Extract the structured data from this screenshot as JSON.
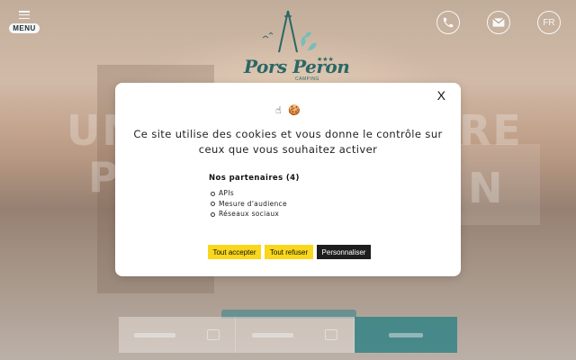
{
  "header": {
    "menu_label": "MENU",
    "lang_label": "FR",
    "logo": {
      "text": "Pors Peron",
      "stars": "★★★",
      "subtitle": "CAMPING"
    }
  },
  "hero": {
    "ghost_1": "UN",
    "ghost_2": "RE",
    "ghost_3": "P",
    "ghost_4": "N"
  },
  "cookie_modal": {
    "close_label": "X",
    "icon_1": "☝",
    "icon_2": "🍪",
    "message": "Ce site utilise des cookies et vous donne le contrôle sur ceux que vous souhaitez activer",
    "partners_title": "Nos partenaires (4)",
    "partners": [
      "APIs",
      "Mesure d'audience",
      "Réseaux sociaux"
    ],
    "accept_label": "Tout accepter",
    "refuse_label": "Tout refuser",
    "customize_label": "Personnaliser"
  },
  "colors": {
    "accent_yellow": "#f9d71c",
    "brand_teal": "#2e6b6a",
    "dark_button": "#1e1e1e"
  }
}
